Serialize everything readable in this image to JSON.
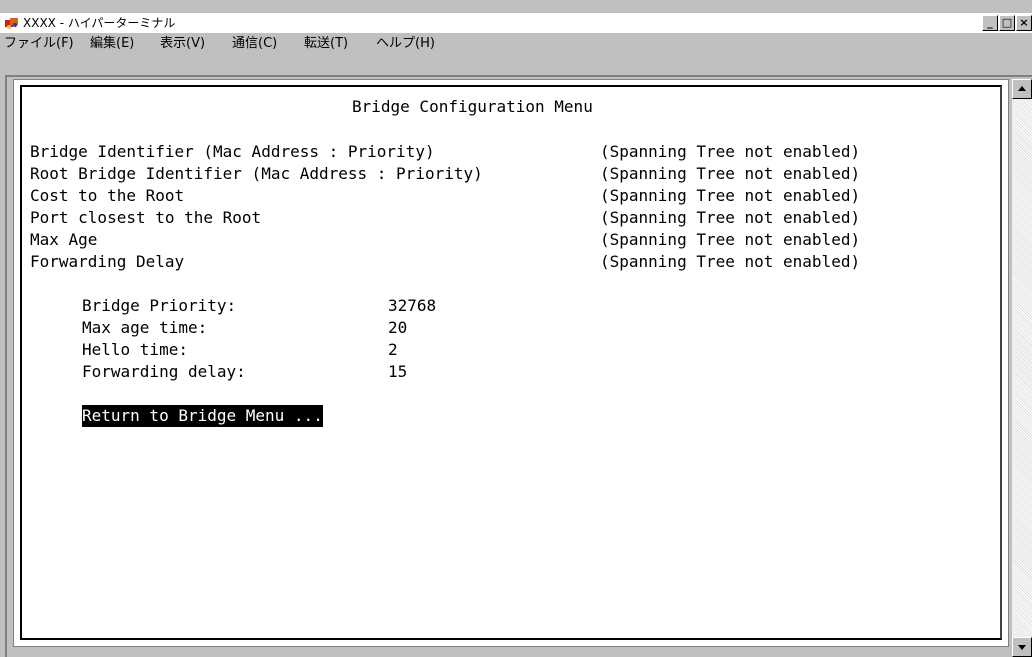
{
  "window": {
    "title": "XXXX - ハイパーターミナル",
    "controls": {
      "minimize": "_",
      "maximize": "□",
      "close": "×"
    }
  },
  "menubar": {
    "items": [
      "ファイル(F)",
      "編集(E)",
      "表示(V)",
      "通信(C)",
      "転送(T)",
      "ヘルプ(H)"
    ]
  },
  "terminal": {
    "title": "Bridge Configuration Menu",
    "status_rows": [
      {
        "label": "Bridge Identifier (Mac Address : Priority)",
        "value": "(Spanning Tree not enabled)"
      },
      {
        "label": "Root Bridge Identifier (Mac Address : Priority)",
        "value": "(Spanning Tree not enabled)"
      },
      {
        "label": "Cost to the Root",
        "value": "(Spanning Tree not enabled)"
      },
      {
        "label": "Port closest to the Root",
        "value": "(Spanning Tree not enabled)"
      },
      {
        "label": "Max Age",
        "value": "(Spanning Tree not enabled)"
      },
      {
        "label": "Forwarding Delay",
        "value": "(Spanning Tree not enabled)"
      }
    ],
    "settings": [
      {
        "label": "Bridge Priority:",
        "value": "32768"
      },
      {
        "label": "Max age time:",
        "value": "20"
      },
      {
        "label": "Hello time:",
        "value": "2"
      },
      {
        "label": "Forwarding delay:",
        "value": "15"
      }
    ],
    "return_option": "Return to Bridge Menu ..."
  },
  "colors": {
    "window_bg": "#c0c0c0",
    "terminal_bg": "#ffffff",
    "terminal_text": "#000000",
    "highlight_bg": "#000000",
    "highlight_text": "#ffffff"
  }
}
